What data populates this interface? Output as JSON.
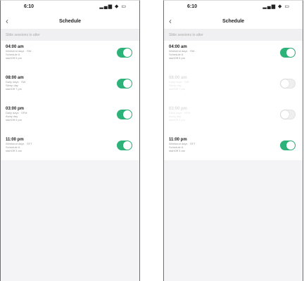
{
  "colors": {
    "accent": "#2db37a"
  },
  "screens": [
    {
      "time": "6:10",
      "status_icons": "▂▄▆ ◆ ▭",
      "title": "Schedule",
      "back_icon": "chevron-left-icon",
      "hint": "Slide sessions to alter",
      "items": [
        {
          "time": "04:00 am",
          "lines": [
            "Weekend days · SW",
            "Schedule A",
            "startOff 5 pm"
          ],
          "enabled": true
        },
        {
          "time": "08:00 am",
          "lines": [
            "Daily days · SW",
            "Sleep day",
            "startOff 7 pm"
          ],
          "enabled": true
        },
        {
          "time": "03:00 pm",
          "lines": [
            "Daily days · SFM",
            "Away day",
            "startOff 9 pm"
          ],
          "enabled": true
        },
        {
          "time": "11:00 pm",
          "lines": [
            "Weekend days · SFT",
            "Schedule A",
            "startOff 3 am"
          ],
          "enabled": true
        }
      ]
    },
    {
      "time": "6:10",
      "status_icons": "▂▄▆ ◆ ▭",
      "title": "Schedule",
      "back_icon": "chevron-left-icon",
      "hint": "Slide sessions to alter",
      "items": [
        {
          "time": "04:00 am",
          "lines": [
            "Weekend days · SW",
            "Schedule A",
            "startOff 5 pm"
          ],
          "enabled": true
        },
        {
          "time": "08:00 am",
          "lines": [
            "Daily days · SW",
            "Sleep day",
            "startOff 7 pm"
          ],
          "enabled": false
        },
        {
          "time": "03:00 pm",
          "lines": [
            "Daily days · SFM",
            "Away day",
            "startOff 9 pm"
          ],
          "enabled": false
        },
        {
          "time": "11:00 pm",
          "lines": [
            "Weekend days · SFT",
            "Schedule A",
            "startOff 3 am"
          ],
          "enabled": true
        }
      ]
    }
  ]
}
